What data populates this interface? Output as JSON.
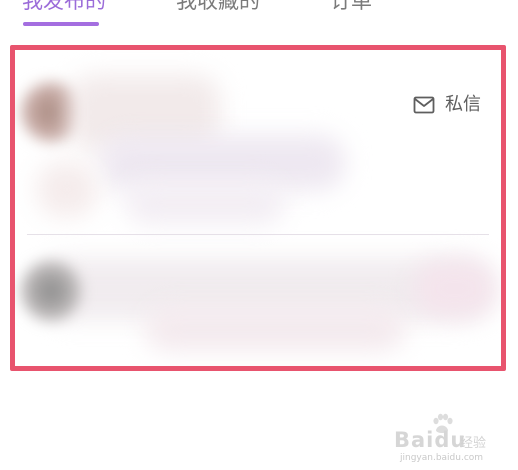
{
  "tabs": [
    {
      "label": "我发布的",
      "active": true
    },
    {
      "label": "我收藏的",
      "active": false
    },
    {
      "label": "订单",
      "active": false
    }
  ],
  "colors": {
    "accent": "#9b6cd9",
    "highlight_border": "#e8546e",
    "text_muted": "#7a7a7a",
    "text_icon": "#5e5e5e"
  },
  "message_card": {
    "action_icon": "mail-icon",
    "action_label": "私信"
  },
  "watermark": {
    "brand": "Baidu",
    "subtitle": "经验",
    "url": "jingyan.baidu.com"
  }
}
